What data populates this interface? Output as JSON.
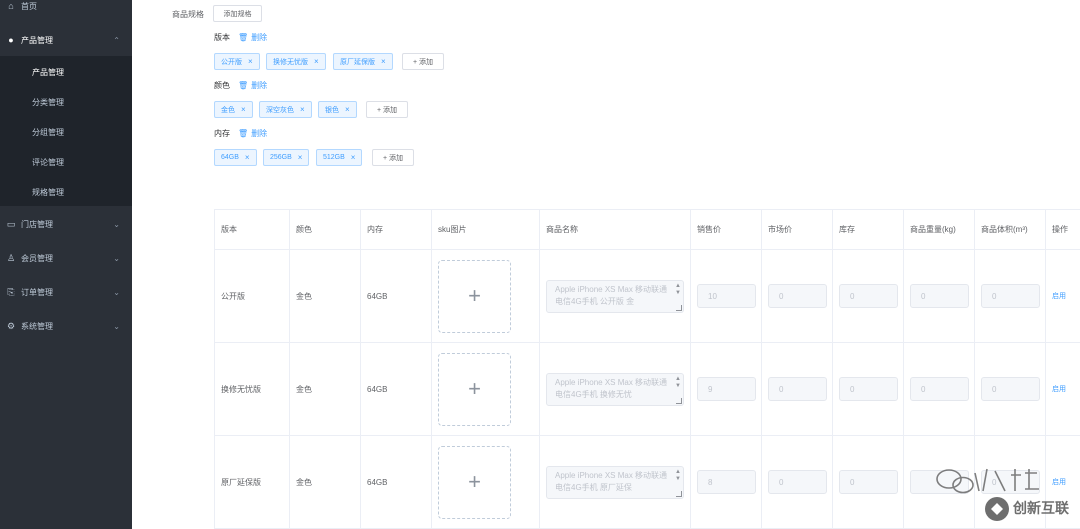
{
  "sidebar": {
    "items": [
      {
        "label": "首页",
        "icon": "home-icon",
        "glyph": "⌂"
      },
      {
        "label": "产品管理",
        "icon": "user-icon",
        "glyph": "●",
        "chevron": "⌃"
      },
      {
        "label": "门店管理",
        "icon": "store-icon",
        "glyph": "▭",
        "chevron": "⌄"
      },
      {
        "label": "会员管理",
        "icon": "member-icon",
        "glyph": "♙",
        "chevron": "⌄"
      },
      {
        "label": "订单管理",
        "icon": "order-icon",
        "glyph": "⎘",
        "chevron": "⌄"
      },
      {
        "label": "系统管理",
        "icon": "settings-icon",
        "glyph": "⚙",
        "chevron": "⌄"
      }
    ],
    "sub_items": [
      "产品管理",
      "分类管理",
      "分组管理",
      "评论管理",
      "规格管理"
    ]
  },
  "spec": {
    "label": "商品规格",
    "add_spec_button": "添加规格",
    "delete_label": "删除",
    "add_value_button": "+ 添加",
    "groups": [
      {
        "name": "版本",
        "values": [
          "公开版",
          "换修无忧版",
          "原厂延保版"
        ]
      },
      {
        "name": "颜色",
        "values": [
          "金色",
          "深空灰色",
          "银色"
        ]
      },
      {
        "name": "内存",
        "values": [
          "64GB",
          "256GB",
          "512GB"
        ]
      }
    ]
  },
  "table": {
    "headers": [
      "版本",
      "颜色",
      "内存",
      "sku图片",
      "商品名称",
      "销售价",
      "市场价",
      "库存",
      "商品重量(kg)",
      "商品体积(m³)",
      "操作"
    ],
    "rows": [
      {
        "version": "公开版",
        "color": "金色",
        "memory": "64GB",
        "name": "Apple iPhone XS Max 移动联通电信4G手机 公开版 金",
        "price": "10",
        "market": "0",
        "stock": "0",
        "weight": "0",
        "volume": "0",
        "action": "启用"
      },
      {
        "version": "换修无忧版",
        "color": "金色",
        "memory": "64GB",
        "name": "Apple iPhone XS Max 移动联通电信4G手机 换修无忧",
        "price": "9",
        "market": "0",
        "stock": "0",
        "weight": "0",
        "volume": "0",
        "action": "启用"
      },
      {
        "version": "原厂延保版",
        "color": "金色",
        "memory": "64GB",
        "name": "Apple iPhone XS Max 移动联通电信4G手机 原厂延保",
        "price": "8",
        "market": "0",
        "stock": "0",
        "weight": "",
        "volume": "0",
        "action": "启用"
      }
    ]
  },
  "watermark": {
    "text": "创新互联"
  },
  "colors": {
    "sidebar": "#2b3038",
    "submenu": "#1f242b",
    "accent": "#409eff",
    "tag_bg": "#ecf5ff"
  }
}
